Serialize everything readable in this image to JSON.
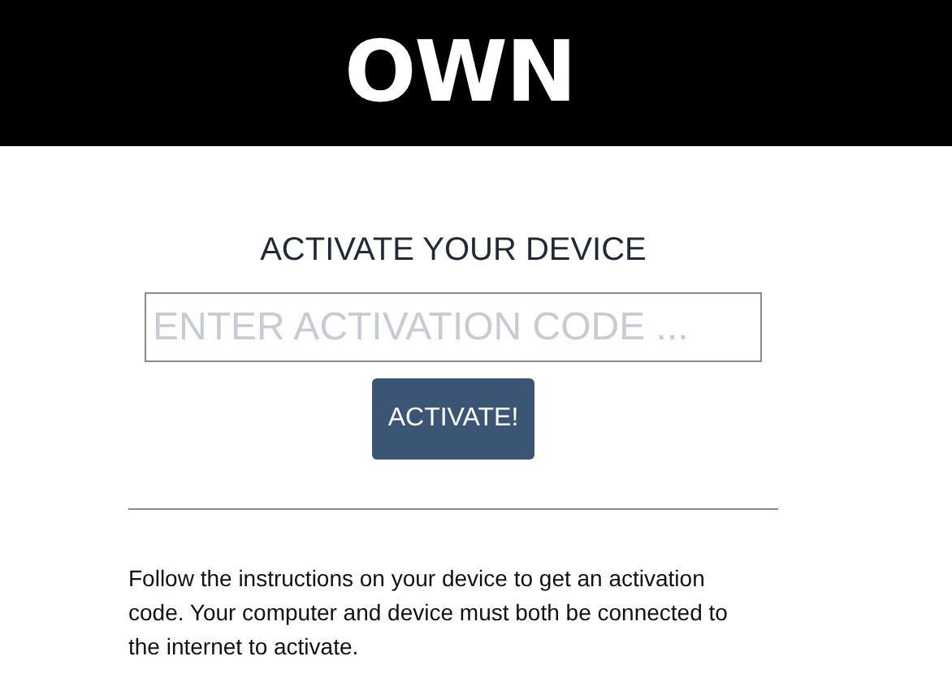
{
  "header": {
    "logo": "OWN"
  },
  "activation": {
    "title": "ACTIVATE YOUR DEVICE",
    "code_field": {
      "placeholder": "ENTER ACTIVATION CODE ..."
    },
    "button": "ACTIVATE!"
  },
  "instructions": "Follow the instructions on your device to get an activation code. Your computer and device must both be connected to the internet to activate."
}
